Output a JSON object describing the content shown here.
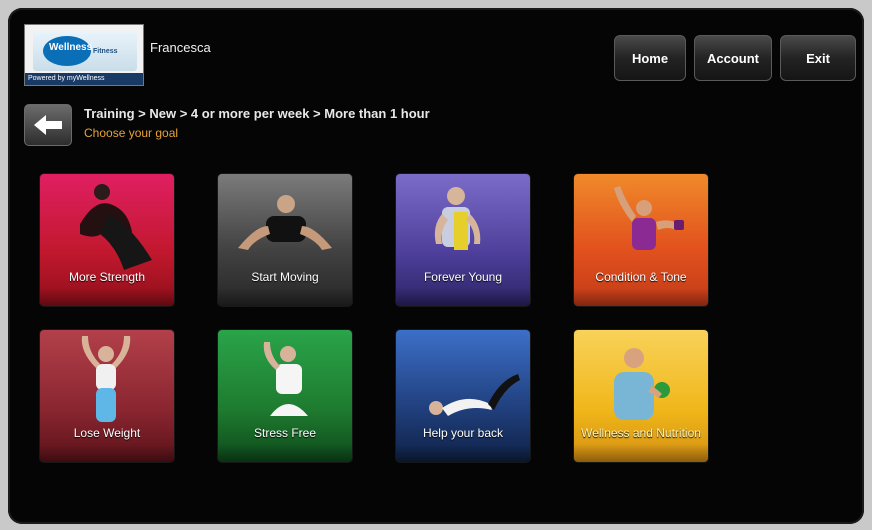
{
  "header": {
    "logo": {
      "text": "Wellness",
      "sub": "Fitness",
      "foot": "Powered by myWellness"
    },
    "user_name": "Francesca",
    "buttons": {
      "home": "Home",
      "account": "Account",
      "exit": "Exit"
    }
  },
  "nav": {
    "breadcrumb": "Training > New > 4 or more per week > More than 1 hour",
    "subtitle": "Choose your goal"
  },
  "goals": [
    {
      "label": "More Strength",
      "color": "#c3172a"
    },
    {
      "label": "Start Moving",
      "color": "#4a4a4a"
    },
    {
      "label": "Forever Young",
      "color": "#4b3e9a"
    },
    {
      "label": "Condition & Tone",
      "color": "#d9531f"
    },
    {
      "label": "Lose Weight",
      "color": "#8b2b34"
    },
    {
      "label": "Stress Free",
      "color": "#1e7b2f"
    },
    {
      "label": "Help your back",
      "color": "#203f7c"
    },
    {
      "label": "Wellness and Nutrition",
      "color": "#f0b71a"
    }
  ]
}
